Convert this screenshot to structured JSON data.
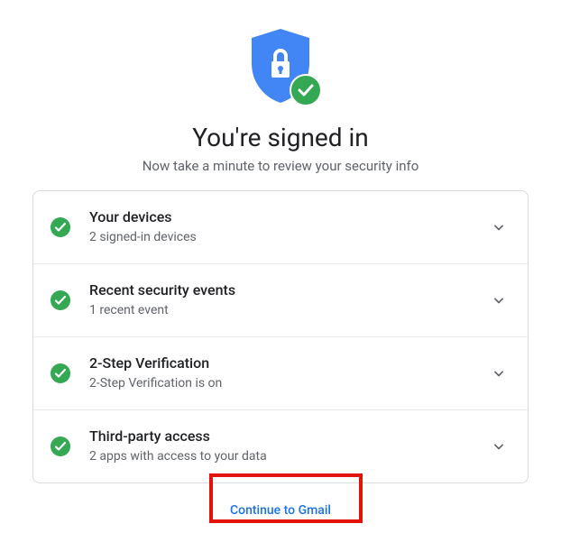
{
  "hero": {
    "title": "You're signed in",
    "subtitle": "Now take a minute to review your security info"
  },
  "rows": [
    {
      "title": "Your devices",
      "sub": "2 signed-in devices"
    },
    {
      "title": "Recent security events",
      "sub": "1 recent event"
    },
    {
      "title": "2-Step Verification",
      "sub": "2-Step Verification is on"
    },
    {
      "title": "Third-party access",
      "sub": "2 apps with access to your data"
    }
  ],
  "footer": {
    "continue": "Continue to Gmail"
  },
  "colors": {
    "accent": "#1a73e8",
    "ok": "#34a853"
  }
}
